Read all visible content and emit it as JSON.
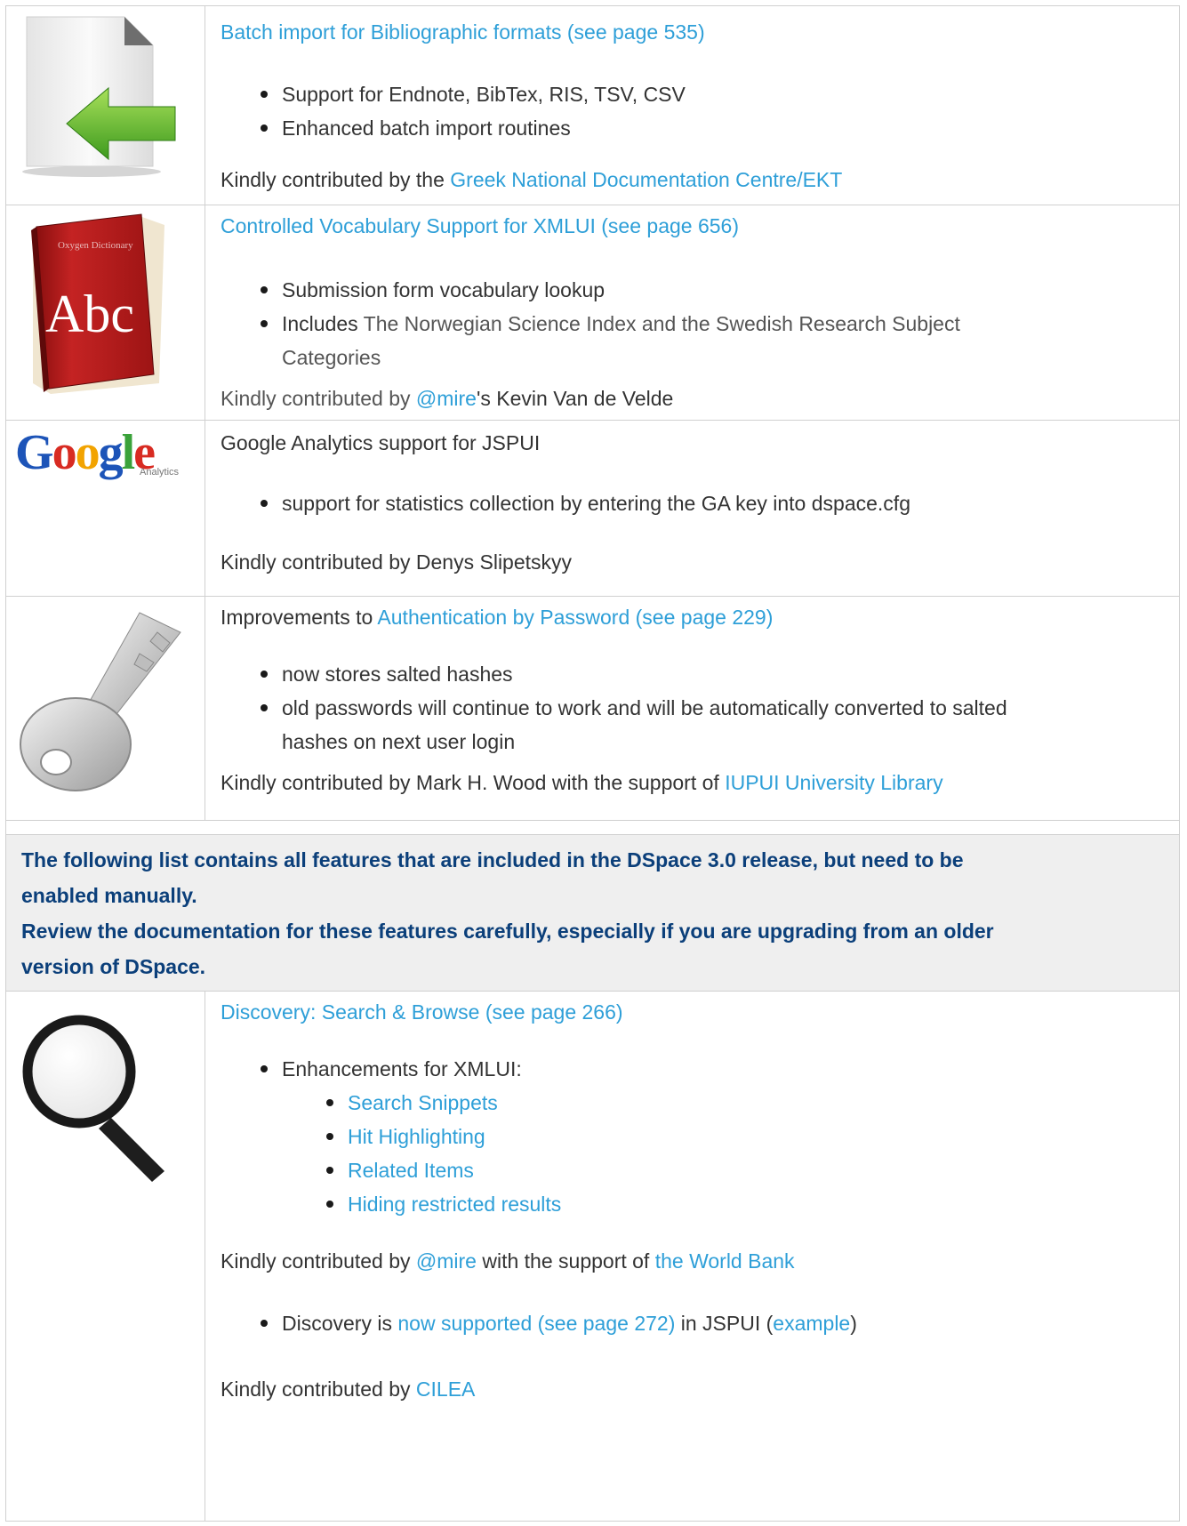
{
  "rows": [
    {
      "icon": "document-import-icon",
      "title_link": "Batch import for Bibliographic formats (see page 535)",
      "bullets": [
        "Support for Endnote, BibTex, RIS, TSV, CSV",
        "Enhanced batch import routines"
      ],
      "credit_prefix": "Kindly contributed by the ",
      "credit_link": "Greek National Documentation Centre/EKT"
    },
    {
      "icon": "dictionary-book-icon",
      "icon_text": "Abc",
      "title_link": "Controlled Vocabulary Support for XMLUI (see page 656)",
      "bullet1": "Submission form vocabulary lookup",
      "bullet2_prefix": "Includes ",
      "bullet2_line1": "The Norwegian Science Index and the Swedish Research Subject",
      "bullet2_line2": "Categories",
      "credit_prefix": "Kindly contributed by ",
      "credit_link": "@mire",
      "credit_suffix": "'s Kevin Van de Velde"
    },
    {
      "icon": "google-analytics-logo",
      "logo_text": "Google",
      "logo_sub": "Analytics",
      "title": "Google Analytics support for JSPUI",
      "bullets": [
        "support for statistics collection by entering the GA key into dspace.cfg"
      ],
      "credit": "Kindly contributed by Denys Slipetskyy"
    },
    {
      "icon": "key-icon",
      "title_prefix": "Improvements to ",
      "title_link": "Authentication by Password (see page 229)",
      "bullet1": "now stores salted hashes",
      "bullet2_line1": "old passwords will continue to work and will be automatically converted to salted",
      "bullet2_line2": "hashes on next user login",
      "credit_prefix": "Kindly contributed by Mark H. Wood with the support of ",
      "credit_link": "IUPUI University Library"
    }
  ],
  "note": {
    "line1": "The following list contains all features that are included in the DSpace 3.0 release, but need to be",
    "line2": "enabled manually.",
    "line3": "Review the documentation for these features carefully, especially if you are upgrading from an older",
    "line4": "version of DSpace."
  },
  "discovery": {
    "icon": "magnifier-icon",
    "title_link": "Discovery: Search & Browse (see page 266)",
    "bullet": "Enhancements for XMLUI:",
    "sub_links": [
      "Search Snippets",
      "Hit Highlighting",
      "Related Items",
      "Hiding restricted results"
    ],
    "credit1_prefix": "Kindly contributed by ",
    "credit1_link1": "@mire",
    "credit1_mid": " with the support of ",
    "credit1_link2": "the World Bank",
    "bullet_b_prefix": "Discovery is ",
    "bullet_b_link": "now supported (see page 272)",
    "bullet_b_mid": " in JSPUI (",
    "bullet_b_link2": "example",
    "bullet_b_suffix": ")",
    "credit2_prefix": "Kindly contributed by ",
    "credit2_link": "CILEA"
  }
}
